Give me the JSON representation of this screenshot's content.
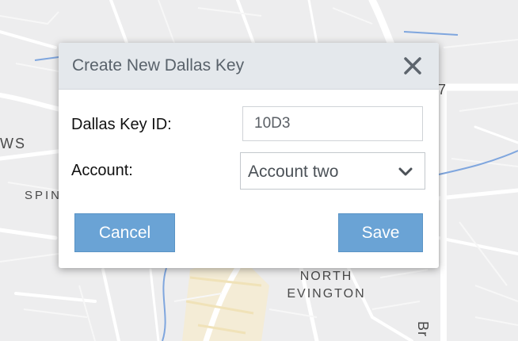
{
  "map": {
    "labels": {
      "north": "NORTH",
      "evington": "EVINGTON",
      "spin": "SPIN",
      "ws": "WS",
      "seven": "7",
      "br": "Br"
    }
  },
  "dialog": {
    "title": "Create New Dallas Key",
    "close_icon": "close-icon",
    "fields": {
      "dallas_key_id": {
        "label": "Dallas Key ID:",
        "value": "10D3"
      },
      "account": {
        "label": "Account:",
        "selected": "Account two",
        "chevron_icon": "chevron-down-icon"
      }
    },
    "buttons": {
      "cancel": "Cancel",
      "save": "Save"
    }
  },
  "colors": {
    "header_bg": "#e4e8ec",
    "title_text": "#59626b",
    "button_bg": "#6aa3d5",
    "map_bg": "#ededee"
  }
}
